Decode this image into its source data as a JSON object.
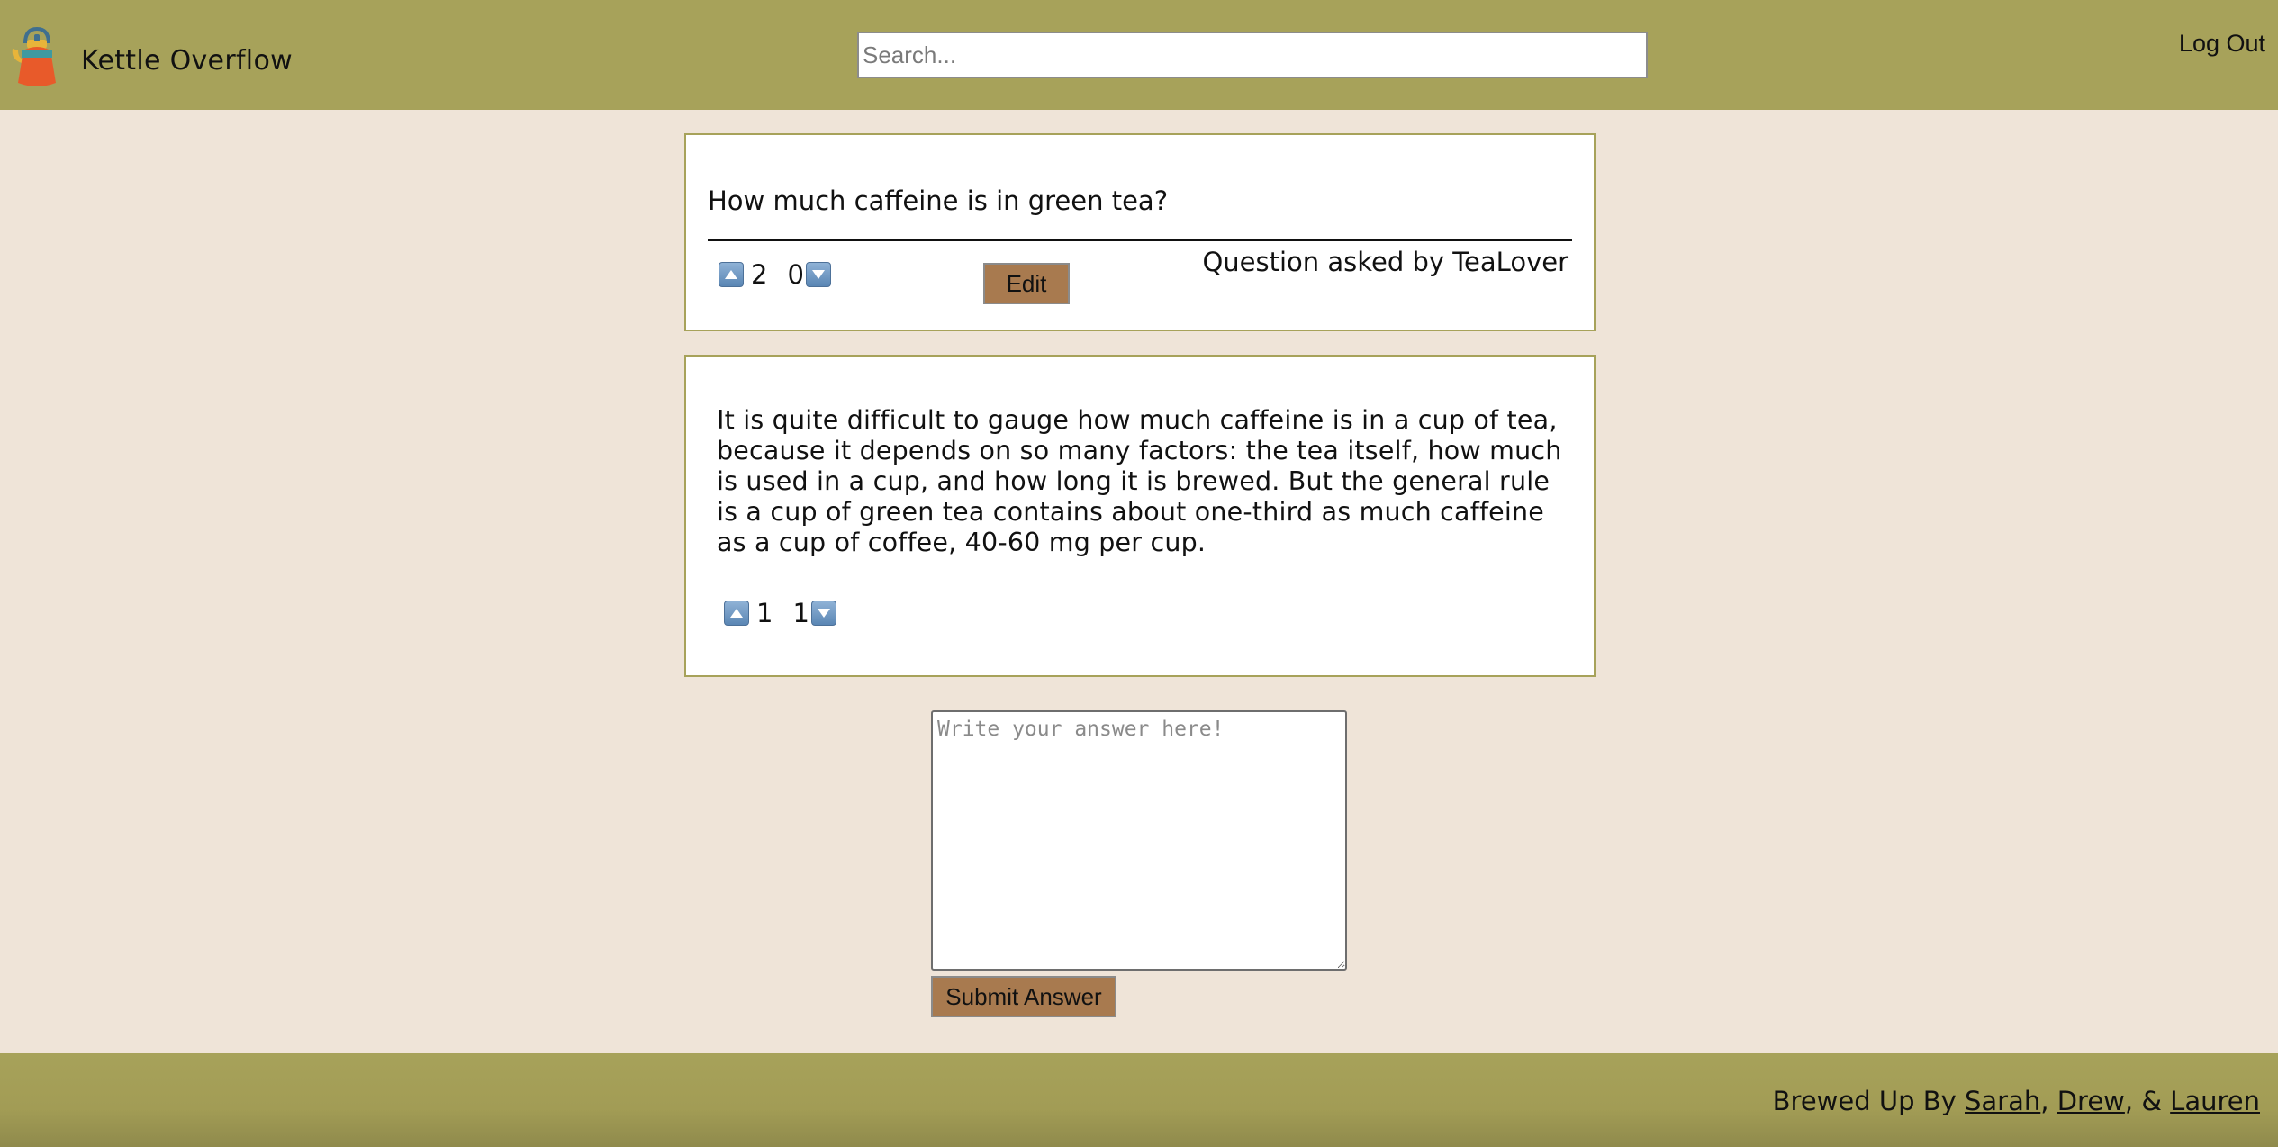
{
  "header": {
    "brand": "Kettle Overflow",
    "logo_icon": "kettle-icon",
    "search_placeholder": "Search...",
    "logout_label": "Log Out"
  },
  "question": {
    "title": "How much caffeine is in green tea?",
    "upvotes": "2",
    "downvotes": "0",
    "edit_label": "Edit",
    "asked_by": "Question asked by TeaLover"
  },
  "answers": [
    {
      "text": "It is quite difficult to gauge how much caffeine is in a cup of tea, because it depends on so many factors: the tea itself, how much is used in a cup, and how long it is brewed. But the general rule is a cup of green tea contains about one-third as much caffeine as a cup of coffee, 40-60 mg per cup.",
      "upvotes": "1",
      "downvotes": "1"
    }
  ],
  "answer_form": {
    "placeholder": "Write your answer here!",
    "submit_label": "Submit Answer"
  },
  "footer": {
    "prefix": "Brewed Up By ",
    "authors": [
      "Sarah",
      "Drew",
      "Lauren"
    ],
    "sep1": ", ",
    "sep2": ", & "
  },
  "colors": {
    "header_bg": "#a7a25a",
    "page_bg": "#efe4d8",
    "button_bg": "#a87a4f",
    "vote_button": "#6f97c4"
  }
}
